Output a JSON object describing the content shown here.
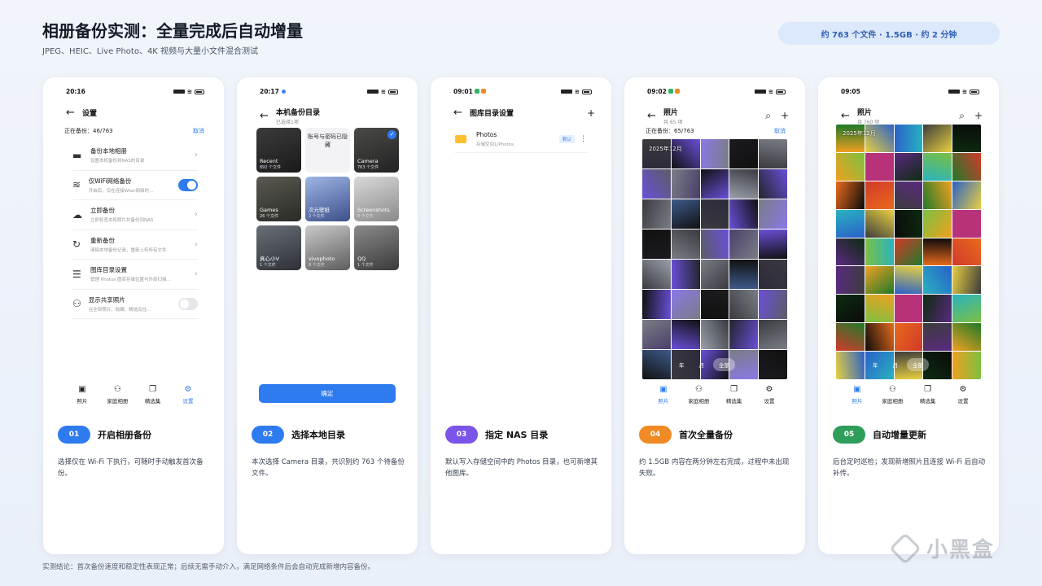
{
  "header": {
    "title": "相册备份实测：全量完成后自动增量",
    "subtitle": "JPEG、HEIC、Live Photo、4K 视频与大量小文件混合测试",
    "summary_pill": "约 763 个文件 · 1.5GB · 约 2 分钟"
  },
  "footer": {
    "conclusion": "实测结论：首次备份速度和稳定性表现正常；后续无需手动介入，满足网络条件后会自动完成新增内容备份。",
    "brand": "小黑盒"
  },
  "colors": {
    "accent": "#2e7bf0",
    "step1": "#2e7bf0",
    "step2": "#2e7bf0",
    "step3": "#7b55e8",
    "step4": "#f08a24",
    "step5": "#2e9e5a"
  },
  "cards": [
    {
      "step_num": "01",
      "step_title": "开启相册备份",
      "desc": "选择仅在 Wi-Fi 下执行，可随时手动触发首次备份。",
      "time": "20:16",
      "screen": {
        "title": "设置",
        "progress_label": "正在备份：46/763",
        "cancel": "取消",
        "items": [
          {
            "title": "备份本地相册",
            "desc": "设置本机备份到NAS的目录",
            "control": "chevron",
            "icon": "folder-icon"
          },
          {
            "title": "仅WiFi网络备份",
            "desc": "开启后，仅在连接Wlan网络时…",
            "control": "toggle-on",
            "icon": "wifi-icon"
          },
          {
            "title": "立即备份",
            "desc": "立即检查本机照片并备份到NAS",
            "control": "chevron",
            "icon": "cloud-upload-icon"
          },
          {
            "title": "重新备份",
            "desc": "清除本地备份记录，重新上传所有文件",
            "control": "chevron",
            "icon": "refresh-icon"
          },
          {
            "title": "图库目录设置",
            "desc": "管理 Photos 图库存储位置与外部扫描…",
            "control": "chevron",
            "icon": "storage-icon"
          },
          {
            "title": "显示共享照片",
            "desc": "在全部照片、收藏、精选及往…",
            "control": "toggle-off",
            "icon": "people-icon"
          }
        ],
        "nav": [
          "照片",
          "家庭相册",
          "精选集",
          "设置"
        ]
      }
    },
    {
      "step_num": "02",
      "step_title": "选择本地目录",
      "desc": "本次选择 Camera 目录，共识别约 763 个待备份文件。",
      "time": "20:17",
      "screen": {
        "title": "本机备份目录",
        "subtitle": "已选择1项",
        "hidden_label": "账号与密码已隐藏",
        "albums": [
          {
            "name": "Recent",
            "count": "892 个文件"
          },
          {
            "name": "",
            "count": ""
          },
          {
            "name": "Camera",
            "count": "763 个文件"
          },
          {
            "name": "Games",
            "count": "26 个文件"
          },
          {
            "name": "次元壁纸",
            "count": "2 个文件"
          },
          {
            "name": "Screenshots",
            "count": "8 个文件"
          },
          {
            "name": "真心小V",
            "count": "1 个文件"
          },
          {
            "name": "vivophoto",
            "count": "8 个文件"
          },
          {
            "name": "QQ",
            "count": "1 个文件"
          }
        ],
        "confirm": "确定"
      }
    },
    {
      "step_num": "03",
      "step_title": "指定 NAS 目录",
      "desc": "默认写入存储空间中的 Photos 目录，也可新增其他图库。",
      "time": "09:01",
      "screen": {
        "title": "图库目录设置",
        "folder_name": "Photos",
        "folder_path": "存储空间1/Photos",
        "default_badge": "默认"
      }
    },
    {
      "step_num": "04",
      "step_title": "首次全量备份",
      "desc": "约 1.5GB 内容在两分钟左右完成，过程中未出现失败。",
      "time": "09:02",
      "screen": {
        "title": "照片",
        "subtitle": "共 65 项",
        "progress_label": "正在备份：65/763",
        "cancel": "取消",
        "date_label": "2025年12月",
        "segments": [
          "年",
          "月",
          "全部"
        ],
        "nav": [
          "照片",
          "家庭相册",
          "精选集",
          "设置"
        ]
      }
    },
    {
      "step_num": "05",
      "step_title": "自动增量更新",
      "desc": "后台定时巡检；发现新增照片且连接 Wi-Fi 后自动补传。",
      "time": "09:05",
      "screen": {
        "title": "照片",
        "subtitle": "共 760 项",
        "date_label": "2025年12月",
        "segments": [
          "年",
          "月",
          "全部"
        ],
        "nav": [
          "照片",
          "家庭相册",
          "精选集",
          "设置"
        ]
      }
    }
  ]
}
